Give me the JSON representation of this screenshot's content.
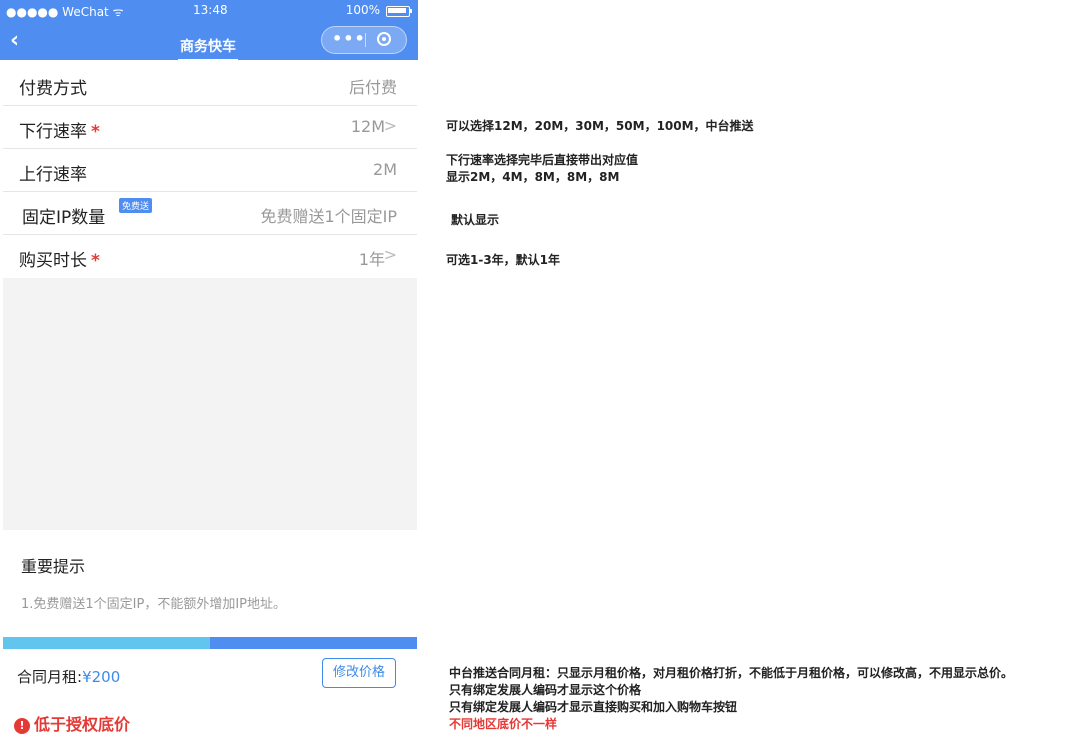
{
  "status_bar": {
    "carrier": "●●●●● WeChat ᯤ",
    "time": "13:48",
    "battery": "100%"
  },
  "nav": {
    "title": "商务快车"
  },
  "form": {
    "rows": [
      {
        "label": "付费方式",
        "value": "后付费"
      },
      {
        "label": "下行速率",
        "value": "12M"
      },
      {
        "label": "上行速率",
        "value": "2M"
      },
      {
        "label": "固定IP数量",
        "badge": "免费送",
        "value": "免费赠送1个固定IP"
      },
      {
        "label": "购买时长",
        "value": "1年"
      }
    ],
    "required_mark": "*"
  },
  "notice": {
    "title": "重要提示",
    "text": "1.免费赠送1个固定IP，不能额外增加IP地址。"
  },
  "bottom": {
    "rent_label": "合同月租:",
    "rent_price": "¥200",
    "modify_button": "修改价格"
  },
  "warning": {
    "icon": "!",
    "text": "低于授权底价"
  },
  "annotations": [
    "可以选择12M，20M，30M，50M，100M，中台推送",
    "下行速率选择完毕后直接带出对应值",
    "显示2M，4M，8M，8M，8M",
    "默认显示",
    "可选1-3年，默认1年",
    "中台推送合同月租：只显示月租价格，对月租价格打折，不能低于月租价格，可以修改高，不用显示总价。",
    "只有绑定发展人编码才显示这个价格",
    "只有绑定发展人编码才显示直接购买和加入购物车按钮",
    "不同地区底价不一样"
  ],
  "colors": {
    "primary": "#4f8df0",
    "accent": "#62c5ee",
    "danger": "#e53935",
    "link": "#3d8bea"
  }
}
